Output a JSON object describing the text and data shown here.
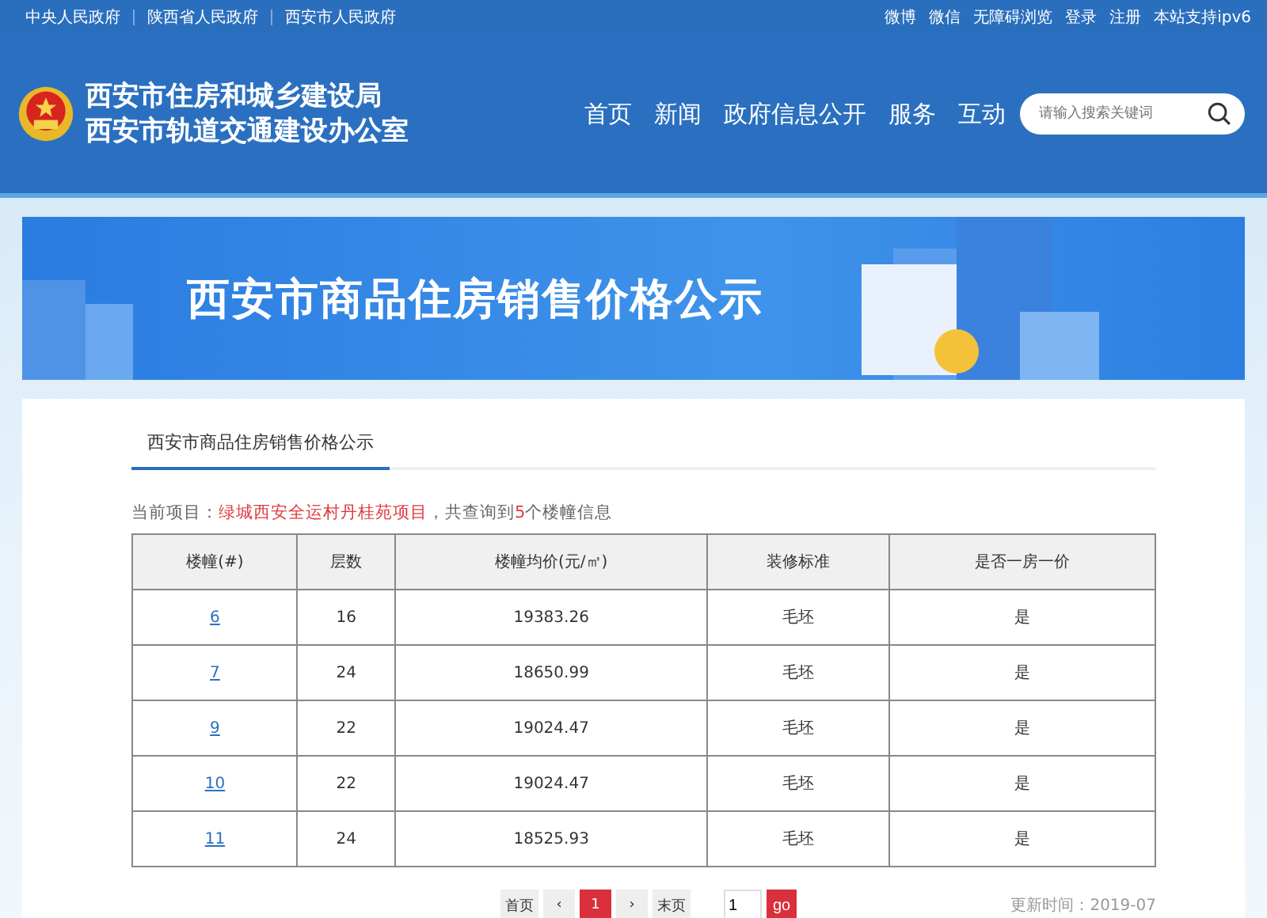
{
  "top_links_left": [
    "中央人民政府",
    "陕西省人民政府",
    "西安市人民政府"
  ],
  "top_links_right": [
    "微博",
    "微信",
    "无障碍浏览",
    "登录",
    "注册",
    "本站支持ipv6"
  ],
  "site_title": [
    "西安市住房和城乡建设局",
    "西安市轨道交通建设办公室"
  ],
  "nav": [
    "首页",
    "新闻",
    "政府信息公开",
    "服务",
    "互动"
  ],
  "search": {
    "placeholder": "请输入搜索关键词"
  },
  "banner": {
    "title": "西安市商品住房销售价格公示"
  },
  "tab": {
    "label": "西安市商品住房销售价格公示",
    "selected": true
  },
  "summary": "当前项目：**绿城西安全运村丹桂苑项目**，共查询到**5**个楼幢信息",
  "table": {
    "columns": [
      "楼幢(#)",
      "层数",
      "楼幢均价(元/㎡)",
      "装修标准",
      "是否一房一价"
    ],
    "rows": [
      [
        "6",
        "16",
        "19383.26",
        "毛坯",
        "是"
      ],
      [
        "7",
        "24",
        "18650.99",
        "毛坯",
        "是"
      ],
      [
        "9",
        "22",
        "19024.47",
        "毛坯",
        "是"
      ],
      [
        "10",
        "22",
        "19024.47",
        "毛坯",
        "是"
      ],
      [
        "11",
        "24",
        "18525.93",
        "毛坯",
        "是"
      ]
    ]
  },
  "pagination": {
    "first": "首页",
    "prev": "‹",
    "pages": [
      {
        "label": "1",
        "selected": true
      }
    ],
    "next": "›",
    "last": "末页",
    "page_input": "1",
    "go": "go"
  },
  "update_time": "更新时间：2019-07"
}
